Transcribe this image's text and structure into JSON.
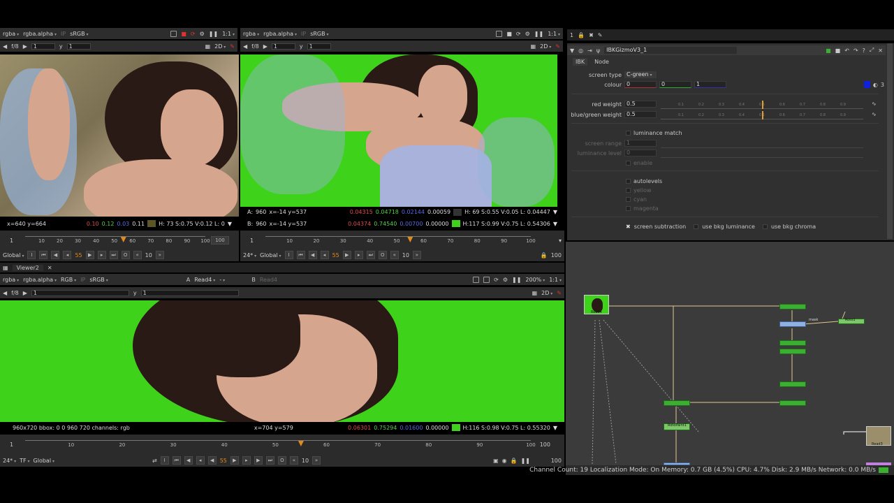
{
  "viewer_top_left": {
    "channels": "rgba",
    "alpha": "rgba.alpha",
    "ip": "IP",
    "colorspace": "sRGB",
    "zoom": "1:1",
    "fstop": "f/8",
    "gain": "1",
    "y_label": "y",
    "gamma": "1",
    "mode": "2D",
    "coords": "x=640 y=664",
    "pixel": {
      "r": "0.10",
      "g": "0.12",
      "b": "0.03",
      "a": "0.11",
      "hsvl": "H: 73 S:0.75 V:0.12  L: 0"
    }
  },
  "viewer_top_right": {
    "channels": "rgba",
    "alpha": "rgba.alpha",
    "ip": "IP",
    "colorspace": "sRGB",
    "zoom": "1:1",
    "fstop": "f/8",
    "gain": "1",
    "y_label": "y",
    "gamma": "1",
    "mode": "2D",
    "row_a": {
      "label": "A:",
      "res": "960",
      "coords": "x=-14 y=537",
      "r": "0.04315",
      "g": "0.04718",
      "b": "0.02144",
      "a": "0.00059",
      "hsvl": "H: 69 S:0.55 V:0.05  L: 0.04447"
    },
    "row_b": {
      "label": "B:",
      "res": "960",
      "coords": "x=-14 y=537",
      "r": "0.04374",
      "g": "0.74540",
      "b": "0.00700",
      "a": "0.00000",
      "hsvl": "H:117 S:0.99 V:0.75  L: 0.54306"
    }
  },
  "timeline_left": {
    "start": "1",
    "end": "100",
    "end_box": "100",
    "ticks": [
      "10",
      "20",
      "30",
      "40",
      "50",
      "60",
      "70",
      "80",
      "90",
      "100"
    ],
    "current_frame": "55",
    "current_fraction": 0.55,
    "scope": "Global",
    "step": "10"
  },
  "timeline_right": {
    "start": "1",
    "end": "100",
    "end_box": "100",
    "ticks": [
      "10",
      "20",
      "30",
      "40",
      "50",
      "60",
      "70",
      "80",
      "90",
      "100"
    ],
    "current_frame": "55",
    "current_fraction": 0.55,
    "fps": "24*",
    "scope": "Global",
    "step": "10"
  },
  "viewer2": {
    "tab_label": "Viewer2",
    "channels": "rgba",
    "alpha": "rgba.alpha",
    "rgb": "RGB",
    "ip": "IP",
    "colorspace": "sRGB",
    "input_a_label": "A",
    "input_a": "Read4",
    "operation": "-",
    "input_b_label": "B",
    "input_b": "Read4",
    "zoom_pct": "200%",
    "zoom": "1:1",
    "fstop": "f/8",
    "gain": "1",
    "y_label": "y",
    "gamma": "1",
    "mode": "2D",
    "format": "960x720  bbox: 0 0 960 720  channels: rgb",
    "coords": "x=704 y=579",
    "pixel": {
      "r": "0.06301",
      "g": "0.75294",
      "b": "0.01600",
      "a": "0.00000",
      "hsvl": "H:116 S:0.98 V:0.75  L: 0.55320"
    }
  },
  "timeline_bottom": {
    "start": "1",
    "end": "100",
    "end_box": "100",
    "end_box2": "100",
    "ticks": [
      "10",
      "20",
      "30",
      "40",
      "50",
      "60",
      "70",
      "80",
      "90",
      "100"
    ],
    "current_frame": "55",
    "current_fraction": 0.55,
    "fps": "24*",
    "tf": "TF",
    "scope": "Global",
    "step": "10"
  },
  "properties": {
    "count": "1",
    "node_name": "IBKGizmoV3_1",
    "tabs": [
      "IBK",
      "Node"
    ],
    "screen_type_label": "screen type",
    "screen_type": "C-green",
    "colour_label": "colour",
    "colour_r": "0",
    "colour_g": "0",
    "colour_b": "1",
    "colour_count": "3",
    "red_weight_label": "red weight",
    "red_weight": "0.5",
    "red_weight_value": 0.5,
    "bg_weight_label": "blue/green weight",
    "bg_weight": "0.5",
    "bg_weight_value": 0.5,
    "luminance_match": "luminance match",
    "screen_range_label": "screen range",
    "screen_range": "1",
    "luminance_level_label": "luminance level",
    "luminance_level": "0",
    "enable": "enable",
    "autolevels": "autolevels",
    "yellow": "yellow",
    "cyan": "cyan",
    "magenta": "magenta",
    "screen_subtraction": "screen subtraction",
    "use_bkg_luminance": "use bkg luminance",
    "use_bkg_chroma": "use bkg chroma",
    "slider_ticks": [
      "0.1",
      "0.2",
      "0.3",
      "0.4",
      "0.5",
      "0.6",
      "0.7",
      "0.8",
      "0.9"
    ]
  },
  "graph": {
    "read_label": "Read4",
    "mask_label": "mask",
    "roto_label": "Roto1",
    "rotopaint_label": "RotoPaint1",
    "read3_label": "Read3"
  },
  "status_bar": "Channel Count: 19  Localization Mode: On  Memory: 0.7 GB (4.5%)  CPU: 4.7%  Disk: 2.9 MB/s  Network: 0.0 MB/s",
  "colors": {
    "green_screen": "#3fd21b",
    "accent": "#e08a20",
    "node_green": "#3cae32"
  }
}
